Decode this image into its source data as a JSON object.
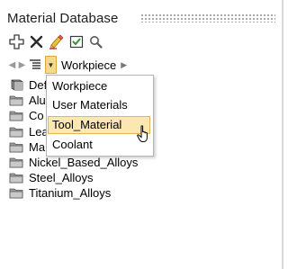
{
  "panel": {
    "title": "Material Database"
  },
  "toolbar": {
    "icons": [
      "add-icon",
      "delete-icon",
      "edit-icon",
      "checklist-icon",
      "search-icon"
    ]
  },
  "navbar": {
    "current_location": "Workpiece"
  },
  "tree": {
    "items": [
      {
        "label": "Def",
        "icon": "database-icon"
      },
      {
        "label": "Alu",
        "icon": "folder-icon"
      },
      {
        "label": "Co",
        "icon": "folder-icon"
      },
      {
        "label": "Lea",
        "icon": "folder-icon"
      },
      {
        "label": "Ma",
        "icon": "folder-icon"
      },
      {
        "label": "Nickel_Based_Alloys",
        "icon": "folder-icon"
      },
      {
        "label": "Steel_Alloys",
        "icon": "folder-icon"
      },
      {
        "label": "Titanium_Alloys",
        "icon": "folder-icon"
      }
    ]
  },
  "dropdown": {
    "items": [
      "Workpiece",
      "User Materials",
      "Tool_Material",
      "Coolant"
    ],
    "highlighted": "Tool_Material"
  },
  "colors": {
    "highlight_bg": "#fbe7b2",
    "highlight_border": "#e3b758",
    "dropdown_button": "#f6d98a"
  }
}
